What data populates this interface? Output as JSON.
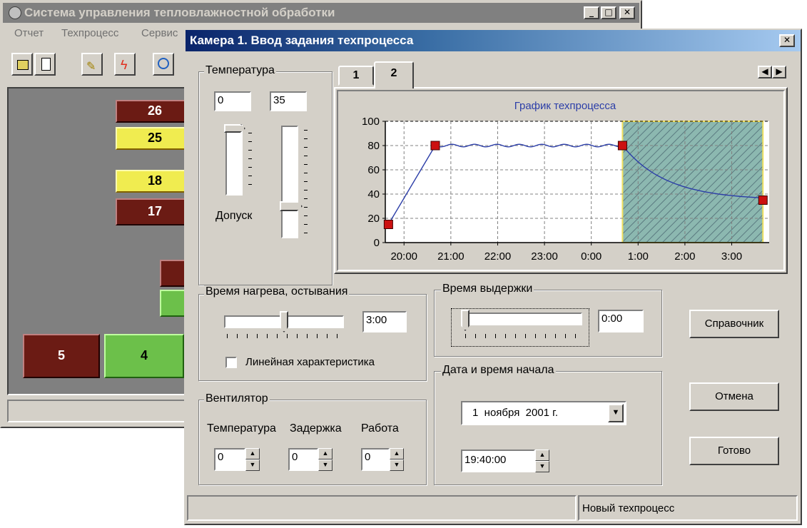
{
  "bg_window": {
    "title": "Система управления тепловлажностной обработки",
    "menu": [
      "Отчет",
      "Техпроцесс",
      "Сервис"
    ],
    "tiles": [
      {
        "value": "26",
        "kind": "dark"
      },
      {
        "value": "25",
        "kind": "yellow"
      },
      {
        "value": "18",
        "kind": "yellow"
      },
      {
        "value": "17",
        "kind": "dark"
      },
      {
        "value": "5",
        "kind": "dark"
      },
      {
        "value": "4",
        "kind": "green"
      }
    ]
  },
  "dialog": {
    "title": "Камера 1. Ввод задания техпроцесса",
    "close_label": "✕",
    "temperature": {
      "label": "Температура",
      "min_value": "0",
      "max_value": "35",
      "tolerance_label": "Допуск"
    },
    "tabs": [
      "1",
      "2"
    ],
    "heat": {
      "label": "Время нагрева, остывания",
      "value": "3:00",
      "linear_label": "Линейная характеристика"
    },
    "hold": {
      "label": "Время выдержки",
      "value": "0:00"
    },
    "fan": {
      "label": "Вентилятор",
      "columns": [
        "Температура",
        "Задержка",
        "Работа"
      ],
      "values": [
        "0",
        "0",
        "0"
      ]
    },
    "start": {
      "label": "Дата и время начала",
      "date": "1  ноября  2001 г.",
      "time": "19:40:00"
    },
    "buttons": {
      "reference": "Справочник",
      "cancel": "Отмена",
      "done": "Готово"
    },
    "status_left": "",
    "status_right": "Новый техпроцесс"
  },
  "chart_data": {
    "type": "line",
    "title": "График техпроцесса",
    "x_ticks": [
      "20:00",
      "21:00",
      "22:00",
      "23:00",
      "0:00",
      "1:00",
      "2:00",
      "3:00"
    ],
    "y_ticks": [
      "0",
      "20",
      "40",
      "60",
      "80",
      "100"
    ],
    "ylim": [
      0,
      100
    ],
    "xlim_hours": [
      19.6,
      27.8
    ],
    "grid": true,
    "colors": {
      "line": "#2c3ea8",
      "marker": "#cc1010",
      "hatch_border": "#f0e060"
    },
    "series": [
      {
        "points": [
          [
            "19:40",
            15
          ],
          [
            "20:40",
            80
          ],
          [
            "0:40",
            80
          ],
          [
            "3:40",
            35
          ]
        ]
      }
    ],
    "markers": [
      [
        "19:40",
        15
      ],
      [
        "20:40",
        80
      ],
      [
        "0:40",
        80
      ],
      [
        "3:40",
        35
      ]
    ],
    "shaded_region": [
      "0:40",
      "3:40"
    ]
  }
}
